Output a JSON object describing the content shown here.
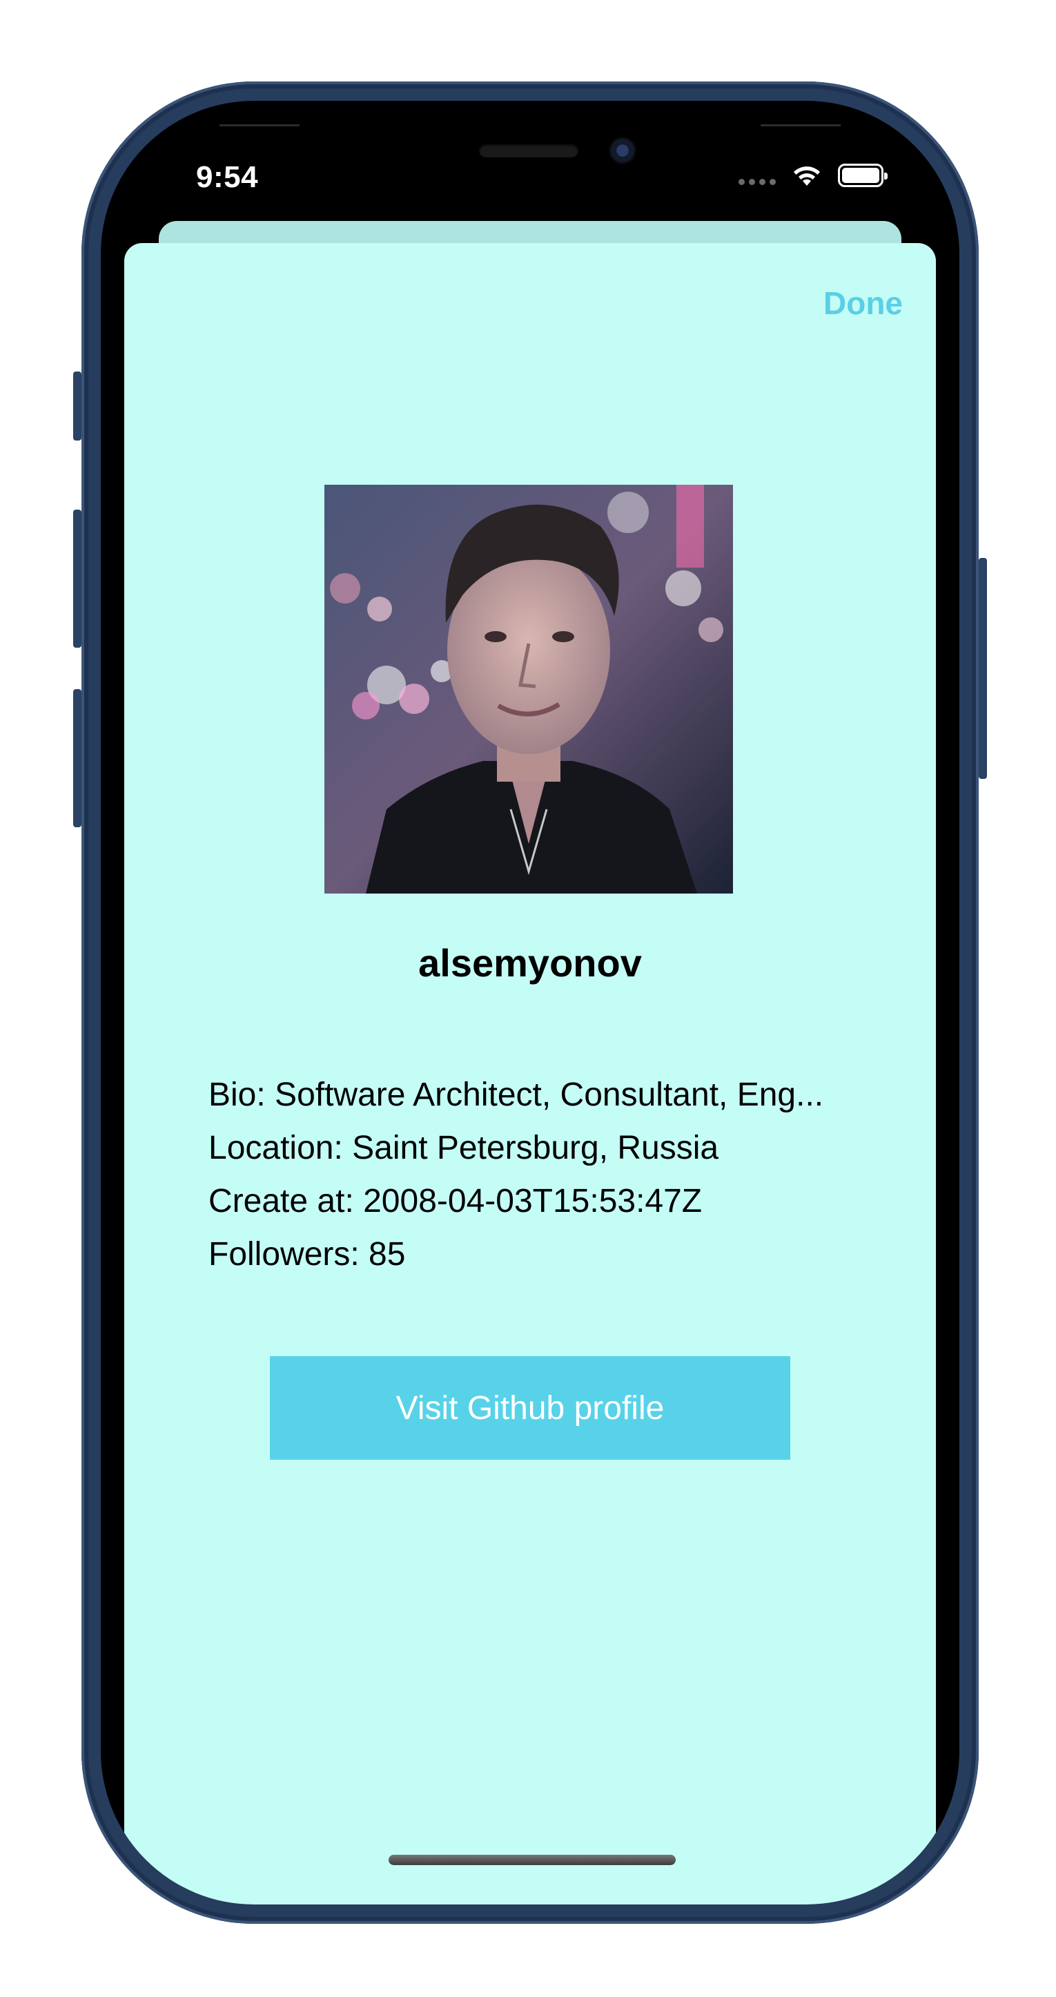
{
  "status_bar": {
    "time": "9:54"
  },
  "sheet": {
    "done_label": "Done",
    "avatar_alt": "alsemyonov",
    "username": "alsemyonov",
    "info": {
      "bio": "Bio: Software Architect, Consultant, Eng...",
      "location": "Location: Saint Petersburg, Russia",
      "created": "Create at: 2008-04-03T15:53:47Z",
      "followers": "Followers: 85"
    },
    "visit_button_label": "Visit Github profile"
  },
  "colors": {
    "sheet_background": "#c4fdf6",
    "back_sheet": "#aee4df",
    "accent": "#58d2e9",
    "done_text": "#5acfe6",
    "phone_frame": "#263d5e"
  },
  "icons": [
    "wifi-icon",
    "battery-icon",
    "cellular-dots-icon"
  ]
}
